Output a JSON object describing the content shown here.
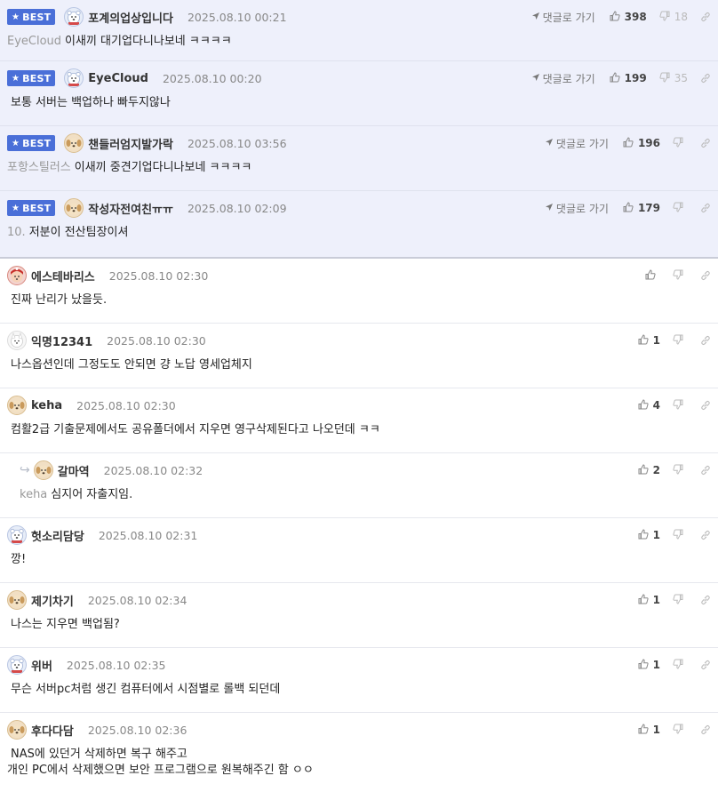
{
  "colors": {
    "best_bg": "#eef0fb",
    "badge": "#4a6fd8"
  },
  "labels": {
    "best": "BEST",
    "goto": "댓글로 가기"
  },
  "comments": [
    {
      "best": true,
      "avatar": "bear",
      "nick": "포계의업상입니다",
      "date": "2025.08.10 00:21",
      "mention": "EyeCloud",
      "text": "이새끼 대기업다니나보네 ㅋㅋㅋㅋ",
      "goto": true,
      "up": "398",
      "down": "18"
    },
    {
      "best": true,
      "avatar": "bear",
      "nick": "EyeCloud",
      "date": "2025.08.10 00:20",
      "mention": "",
      "text": "보통 서버는 백업하나 빠두지않나",
      "goto": true,
      "up": "199",
      "down": "35"
    },
    {
      "best": true,
      "avatar": "dog",
      "nick": "챈들러엄지발가락",
      "date": "2025.08.10 03:56",
      "mention": "포항스틸러스",
      "text": "이새끼 중견기업다니나보네 ㅋㅋㅋㅋ",
      "goto": true,
      "up": "196",
      "down": ""
    },
    {
      "best": true,
      "avatar": "dog",
      "nick": "작성자전여친ㅠㅠ",
      "date": "2025.08.10 02:09",
      "mention": "10.",
      "text": "저분이 전산팀장이셔",
      "goto": true,
      "up": "179",
      "down": ""
    },
    {
      "best": false,
      "avatar": "red",
      "nick": "에스테바리스",
      "date": "2025.08.10 02:30",
      "mention": "",
      "text": "진짜 난리가 났을듯.",
      "up": "",
      "down": ""
    },
    {
      "best": false,
      "avatar": "white",
      "nick": "익명12341",
      "date": "2025.08.10 02:30",
      "mention": "",
      "text": "나스옵션인데 그정도도 안되면 걍 노답 영세업체지",
      "up": "1",
      "down": ""
    },
    {
      "best": false,
      "avatar": "dog",
      "nick": "keha",
      "date": "2025.08.10 02:30",
      "mention": "",
      "text": "컴활2급 기출문제에서도 공유폴더에서 지우면 영구삭제된다고 나오던데 ㅋㅋ",
      "up": "4",
      "down": ""
    },
    {
      "best": false,
      "reply": true,
      "avatar": "dog",
      "nick": "갈마역",
      "date": "2025.08.10 02:32",
      "mention": "keha",
      "text": "심지어 자출지임.",
      "up": "2",
      "down": ""
    },
    {
      "best": false,
      "avatar": "bear",
      "nick": "헛소리담당",
      "date": "2025.08.10 02:31",
      "mention": "",
      "text": "깡!",
      "up": "1",
      "down": ""
    },
    {
      "best": false,
      "avatar": "dog",
      "nick": "제기차기",
      "date": "2025.08.10 02:34",
      "mention": "",
      "text": "나스는 지우면 백업됨?",
      "up": "1",
      "down": ""
    },
    {
      "best": false,
      "avatar": "bear",
      "nick": "위버",
      "date": "2025.08.10 02:35",
      "mention": "",
      "text": "무슨 서버pc처럼 생긴 컴퓨터에서 시점별로 롤백 되던데",
      "up": "1",
      "down": ""
    },
    {
      "best": false,
      "avatar": "dog",
      "nick": "후다다담",
      "date": "2025.08.10 02:36",
      "mention": "",
      "text": "NAS에 있던거 삭제하면 복구 해주고",
      "text2": "개인 PC에서 삭제했으면 보안 프로그램으로 원복해주긴 함 ㅇㅇ",
      "up": "1",
      "down": ""
    }
  ]
}
